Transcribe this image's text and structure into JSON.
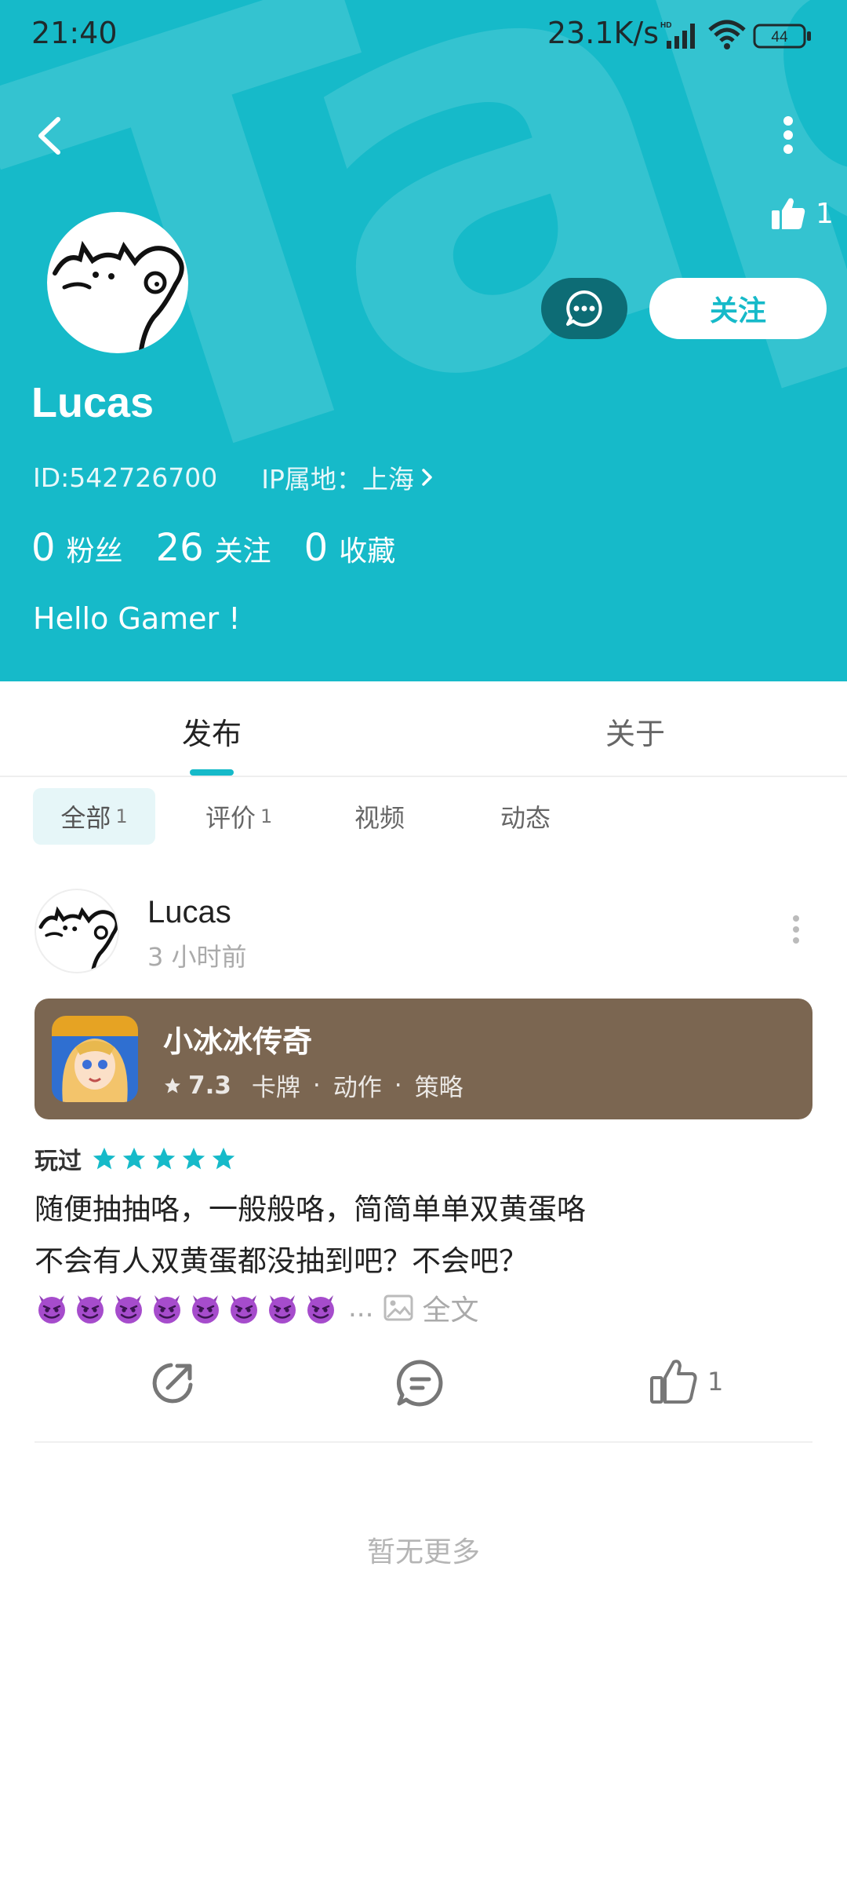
{
  "status_bar": {
    "time": "21:40",
    "speed": "23.1K/s",
    "battery": "44"
  },
  "header": {
    "watermark": "TapTap",
    "like_count": "1",
    "follow_label": "关注",
    "username": "Lucas",
    "user_id": "ID:542726700",
    "ip_location": "IP属地：上海",
    "stats": [
      {
        "value": "0",
        "label": "粉丝"
      },
      {
        "value": "26",
        "label": "关注"
      },
      {
        "value": "0",
        "label": "收藏"
      }
    ],
    "bio": "Hello Gamer !"
  },
  "tabs": [
    {
      "label": "发布",
      "active": true
    },
    {
      "label": "关于",
      "active": false
    }
  ],
  "filters": [
    {
      "label": "全部",
      "count": "1",
      "active": true
    },
    {
      "label": "评价",
      "count": "1",
      "active": false
    },
    {
      "label": "视频",
      "count": "",
      "active": false
    },
    {
      "label": "动态",
      "count": "",
      "active": false
    }
  ],
  "post": {
    "author": "Lucas",
    "time": "3 小时前",
    "game": {
      "title": "小冰冰传奇",
      "score": "7.3",
      "tags": [
        "卡牌",
        "动作",
        "策略"
      ],
      "card_color": "#7b6651"
    },
    "played_label": "玩过",
    "stars": 5,
    "star_color": "#16bac9",
    "text_lines": [
      "随便抽抽咯，一般般咯，简简单单双黄蛋咯",
      "不会有人双黄蛋都没抽到吧？不会吧？"
    ],
    "emoji_count": 8,
    "ellipsis": "...",
    "full_text_label": "全文",
    "like_count": "1"
  },
  "footer": {
    "no_more": "暂无更多"
  },
  "colors": {
    "accent": "#16bac9",
    "message_button": "#0d6c75"
  }
}
